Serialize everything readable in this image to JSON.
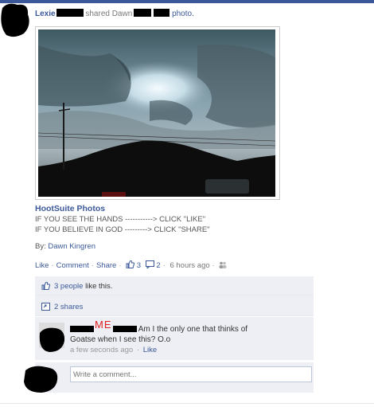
{
  "story": {
    "actor": "Lexie",
    "verb": "shared Dawn",
    "object": "photo."
  },
  "attachment": {
    "source": "HootSuite Photos",
    "line1": "IF YOU SEE THE HANDS -----------> CLICK \"LIKE\"",
    "line2": "IF YOU BELIEVE IN GOD ---------> CLICK \"SHARE\"",
    "by_label": "By:",
    "by_name": "Dawn Kingren"
  },
  "actions": {
    "like": "Like",
    "comment": "Comment",
    "share": "Share",
    "like_count": "3",
    "comment_count": "2",
    "timestamp": "6 hours ago"
  },
  "ufi": {
    "likes_link": "3 people",
    "likes_suffix": "like this.",
    "shares": "2 shares"
  },
  "comment": {
    "annotation": "ME",
    "line1": "Am I the only one that thinks of",
    "line2": "Goatse when I see this? O.o",
    "time": "a few seconds ago",
    "like": "Like"
  },
  "composer": {
    "placeholder": "Write a comment..."
  },
  "colors": {
    "brand": "#3b5998",
    "annotation": "#e02020"
  }
}
